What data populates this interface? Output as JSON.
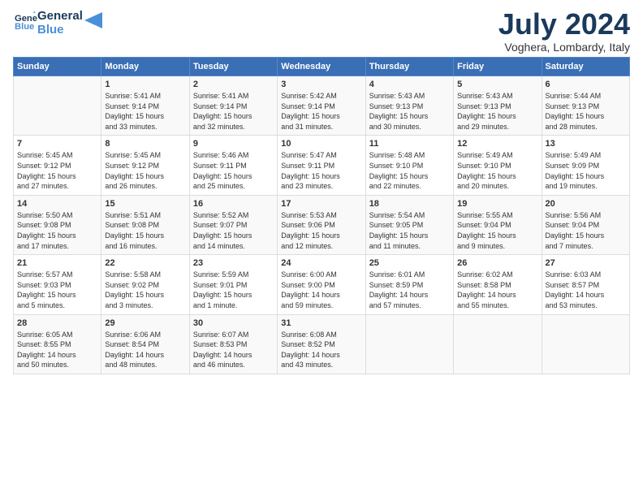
{
  "header": {
    "logo_line1": "General",
    "logo_line2": "Blue",
    "month_title": "July 2024",
    "subtitle": "Voghera, Lombardy, Italy"
  },
  "columns": [
    "Sunday",
    "Monday",
    "Tuesday",
    "Wednesday",
    "Thursday",
    "Friday",
    "Saturday"
  ],
  "weeks": [
    [
      {
        "day": "",
        "text": ""
      },
      {
        "day": "1",
        "text": "Sunrise: 5:41 AM\nSunset: 9:14 PM\nDaylight: 15 hours\nand 33 minutes."
      },
      {
        "day": "2",
        "text": "Sunrise: 5:41 AM\nSunset: 9:14 PM\nDaylight: 15 hours\nand 32 minutes."
      },
      {
        "day": "3",
        "text": "Sunrise: 5:42 AM\nSunset: 9:14 PM\nDaylight: 15 hours\nand 31 minutes."
      },
      {
        "day": "4",
        "text": "Sunrise: 5:43 AM\nSunset: 9:13 PM\nDaylight: 15 hours\nand 30 minutes."
      },
      {
        "day": "5",
        "text": "Sunrise: 5:43 AM\nSunset: 9:13 PM\nDaylight: 15 hours\nand 29 minutes."
      },
      {
        "day": "6",
        "text": "Sunrise: 5:44 AM\nSunset: 9:13 PM\nDaylight: 15 hours\nand 28 minutes."
      }
    ],
    [
      {
        "day": "7",
        "text": "Sunrise: 5:45 AM\nSunset: 9:12 PM\nDaylight: 15 hours\nand 27 minutes."
      },
      {
        "day": "8",
        "text": "Sunrise: 5:45 AM\nSunset: 9:12 PM\nDaylight: 15 hours\nand 26 minutes."
      },
      {
        "day": "9",
        "text": "Sunrise: 5:46 AM\nSunset: 9:11 PM\nDaylight: 15 hours\nand 25 minutes."
      },
      {
        "day": "10",
        "text": "Sunrise: 5:47 AM\nSunset: 9:11 PM\nDaylight: 15 hours\nand 23 minutes."
      },
      {
        "day": "11",
        "text": "Sunrise: 5:48 AM\nSunset: 9:10 PM\nDaylight: 15 hours\nand 22 minutes."
      },
      {
        "day": "12",
        "text": "Sunrise: 5:49 AM\nSunset: 9:10 PM\nDaylight: 15 hours\nand 20 minutes."
      },
      {
        "day": "13",
        "text": "Sunrise: 5:49 AM\nSunset: 9:09 PM\nDaylight: 15 hours\nand 19 minutes."
      }
    ],
    [
      {
        "day": "14",
        "text": "Sunrise: 5:50 AM\nSunset: 9:08 PM\nDaylight: 15 hours\nand 17 minutes."
      },
      {
        "day": "15",
        "text": "Sunrise: 5:51 AM\nSunset: 9:08 PM\nDaylight: 15 hours\nand 16 minutes."
      },
      {
        "day": "16",
        "text": "Sunrise: 5:52 AM\nSunset: 9:07 PM\nDaylight: 15 hours\nand 14 minutes."
      },
      {
        "day": "17",
        "text": "Sunrise: 5:53 AM\nSunset: 9:06 PM\nDaylight: 15 hours\nand 12 minutes."
      },
      {
        "day": "18",
        "text": "Sunrise: 5:54 AM\nSunset: 9:05 PM\nDaylight: 15 hours\nand 11 minutes."
      },
      {
        "day": "19",
        "text": "Sunrise: 5:55 AM\nSunset: 9:04 PM\nDaylight: 15 hours\nand 9 minutes."
      },
      {
        "day": "20",
        "text": "Sunrise: 5:56 AM\nSunset: 9:04 PM\nDaylight: 15 hours\nand 7 minutes."
      }
    ],
    [
      {
        "day": "21",
        "text": "Sunrise: 5:57 AM\nSunset: 9:03 PM\nDaylight: 15 hours\nand 5 minutes."
      },
      {
        "day": "22",
        "text": "Sunrise: 5:58 AM\nSunset: 9:02 PM\nDaylight: 15 hours\nand 3 minutes."
      },
      {
        "day": "23",
        "text": "Sunrise: 5:59 AM\nSunset: 9:01 PM\nDaylight: 15 hours\nand 1 minute."
      },
      {
        "day": "24",
        "text": "Sunrise: 6:00 AM\nSunset: 9:00 PM\nDaylight: 14 hours\nand 59 minutes."
      },
      {
        "day": "25",
        "text": "Sunrise: 6:01 AM\nSunset: 8:59 PM\nDaylight: 14 hours\nand 57 minutes."
      },
      {
        "day": "26",
        "text": "Sunrise: 6:02 AM\nSunset: 8:58 PM\nDaylight: 14 hours\nand 55 minutes."
      },
      {
        "day": "27",
        "text": "Sunrise: 6:03 AM\nSunset: 8:57 PM\nDaylight: 14 hours\nand 53 minutes."
      }
    ],
    [
      {
        "day": "28",
        "text": "Sunrise: 6:05 AM\nSunset: 8:55 PM\nDaylight: 14 hours\nand 50 minutes."
      },
      {
        "day": "29",
        "text": "Sunrise: 6:06 AM\nSunset: 8:54 PM\nDaylight: 14 hours\nand 48 minutes."
      },
      {
        "day": "30",
        "text": "Sunrise: 6:07 AM\nSunset: 8:53 PM\nDaylight: 14 hours\nand 46 minutes."
      },
      {
        "day": "31",
        "text": "Sunrise: 6:08 AM\nSunset: 8:52 PM\nDaylight: 14 hours\nand 43 minutes."
      },
      {
        "day": "",
        "text": ""
      },
      {
        "day": "",
        "text": ""
      },
      {
        "day": "",
        "text": ""
      }
    ]
  ]
}
